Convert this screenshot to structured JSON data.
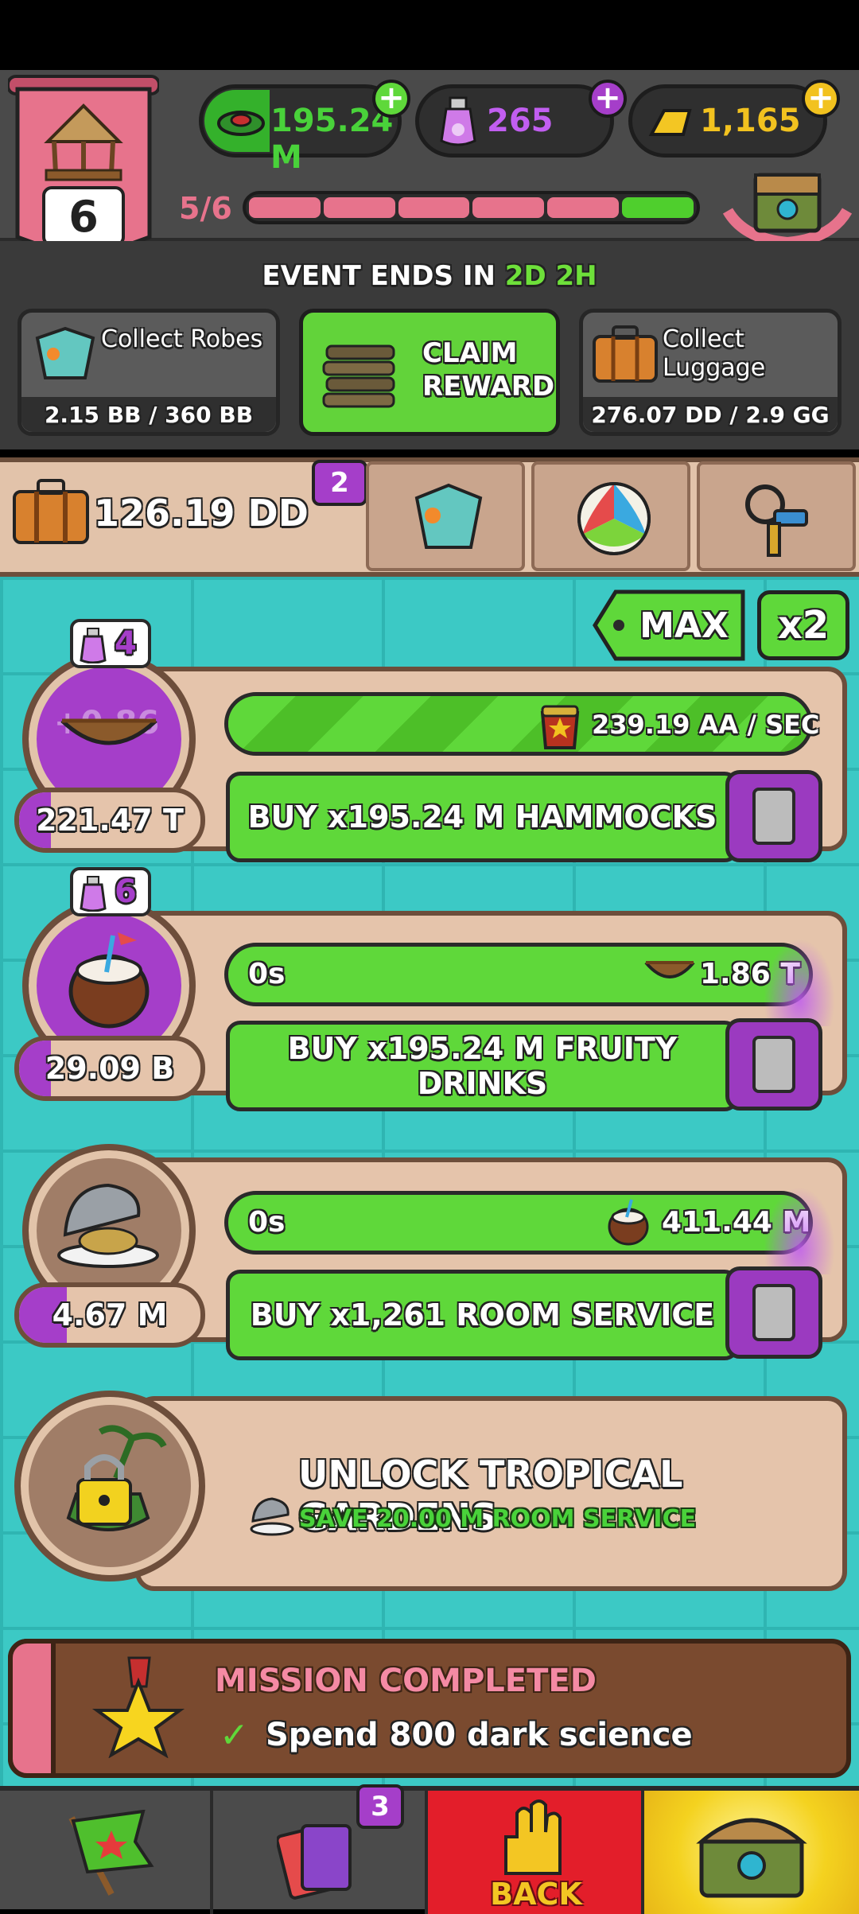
{
  "header": {
    "level": "6",
    "level_progress": "5/6",
    "level_progress_fraction": 0.8333,
    "currencies": [
      {
        "name": "cash",
        "value": "195.24 M",
        "icon": "cash-icon"
      },
      {
        "name": "dark-science",
        "value": "265",
        "icon": "vial-icon"
      },
      {
        "name": "gold",
        "value": "1,165",
        "icon": "gold-bar-icon"
      }
    ]
  },
  "event": {
    "ends_label": "EVENT ENDS IN",
    "ends_days": "2D",
    "ends_hours": "2H",
    "tasks": [
      {
        "label": "Collect Robes",
        "progress": "2.15 BB / 360 BB",
        "icon": "robe-icon"
      },
      {
        "label": "CLAIM REWARD",
        "icon": "hammock-stack-icon"
      },
      {
        "label": "Collect Luggage",
        "progress": "276.07 DD / 2.9 GG",
        "icon": "luggage-icon"
      }
    ]
  },
  "resource": {
    "value": "126.19 DD",
    "badge": "2",
    "tabs": [
      "robe-icon",
      "beach-ball-icon",
      "keys-icon"
    ]
  },
  "controls": {
    "max_label": "MAX",
    "multiplier_label": "x2"
  },
  "producers": [
    {
      "name": "hammocks",
      "vial_count": "4",
      "amount": "221.47 T",
      "rate": "239.19 AA / SEC",
      "buy_label": "BUY x195.24 M HAMMOCKS",
      "ghost": "+0.86"
    },
    {
      "name": "fruity-drinks",
      "vial_count": "6",
      "amount": "29.09 B",
      "timer": "0s",
      "output": "1.86 T",
      "buy_label": "BUY x195.24 M FRUITY DRINKS"
    },
    {
      "name": "room-service",
      "amount": "4.67 M",
      "timer": "0s",
      "output": "411.44 M",
      "buy_label": "BUY x1,261 ROOM SERVICE"
    }
  ],
  "unlock": {
    "title": "UNLOCK TROPICAL GARDENS",
    "subtitle": "SAVE 20.00 M ROOM SERVICE"
  },
  "mission": {
    "title": "MISSION COMPLETED",
    "text": "Spend 800 dark science"
  },
  "nav": {
    "cards_badge": "3",
    "back_label": "BACK"
  },
  "colors": {
    "accent_green": "#5fd83a",
    "accent_purple": "#a53ec9",
    "panel_tan": "#e5c4ab",
    "banner_pink": "#e7738c",
    "water": "#3cc9c5"
  }
}
